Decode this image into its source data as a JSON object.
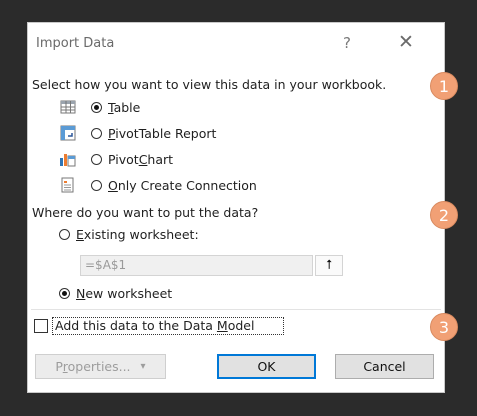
{
  "dialog": {
    "title": "Import Data",
    "help_glyph": "?",
    "close_glyph": "✕"
  },
  "view_section": {
    "prompt": "Select how you want to view this data in your workbook.",
    "options": [
      {
        "label": "Table",
        "selected": true,
        "icon": "table-icon"
      },
      {
        "label": "PivotTable Report",
        "selected": false,
        "icon": "pivottable-icon"
      },
      {
        "label": "PivotChart",
        "selected": false,
        "icon": "pivotchart-icon"
      },
      {
        "label": "Only Create Connection",
        "selected": false,
        "icon": "connection-icon"
      }
    ]
  },
  "location_section": {
    "prompt": "Where do you want to put the data?",
    "existing_label": "Existing worksheet:",
    "existing_selected": false,
    "range_value": "=$A$1",
    "new_label": "New worksheet",
    "new_selected": true
  },
  "data_model": {
    "label": "Add this data to the Data Model",
    "checked": false
  },
  "buttons": {
    "properties": "Properties...",
    "properties_arrow": "▾",
    "ok": "OK",
    "cancel": "Cancel",
    "collapse_glyph": "⭡"
  },
  "callouts": [
    "1",
    "2",
    "3"
  ],
  "colors": {
    "badge": "#f1a075",
    "focus_blue": "#0078d7"
  }
}
